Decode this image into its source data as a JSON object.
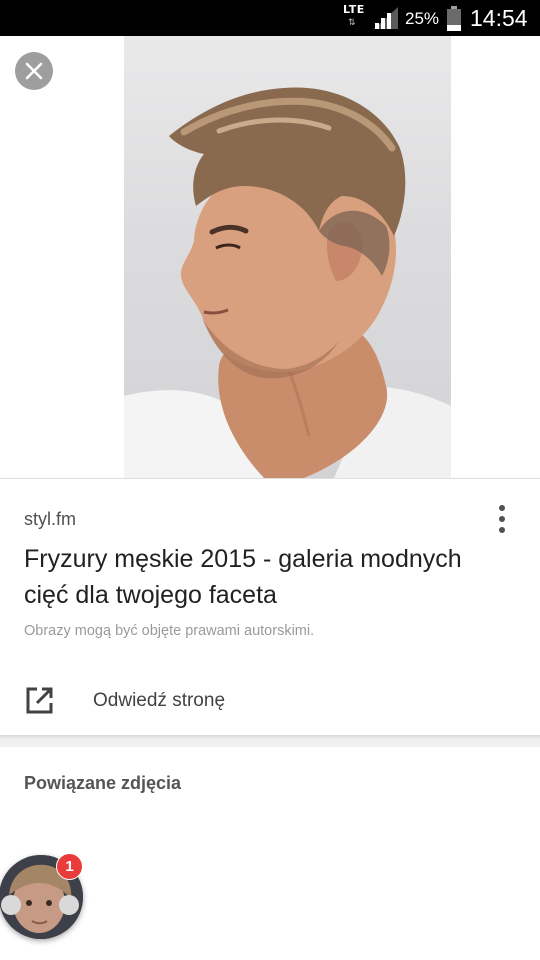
{
  "status_bar": {
    "network": "LTE",
    "data_arrows": "⇅",
    "battery_percent": "25%",
    "time": "14:54",
    "signal_level": 0.75,
    "battery_level": 0.25
  },
  "viewer": {
    "close_icon": "close-icon"
  },
  "result": {
    "source": "styl.fm",
    "title": "Fryzury męskie 2015 - galeria modnych cięć dla twojego faceta",
    "copyright_note": "Obrazy mogą być objęte prawami autorskimi.",
    "more_icon": "more-vert-icon"
  },
  "actions": {
    "visit_label": "Odwiedź stronę",
    "visit_icon": "open-in-new-icon"
  },
  "related": {
    "heading": "Powiązane zdjęcia"
  },
  "chat_head": {
    "badge_count": "1"
  },
  "colors": {
    "status_bar_bg": "#000000",
    "badge_red": "#ea3b3b",
    "close_button_bg": "#9e9e9e",
    "title_text": "#212121"
  }
}
